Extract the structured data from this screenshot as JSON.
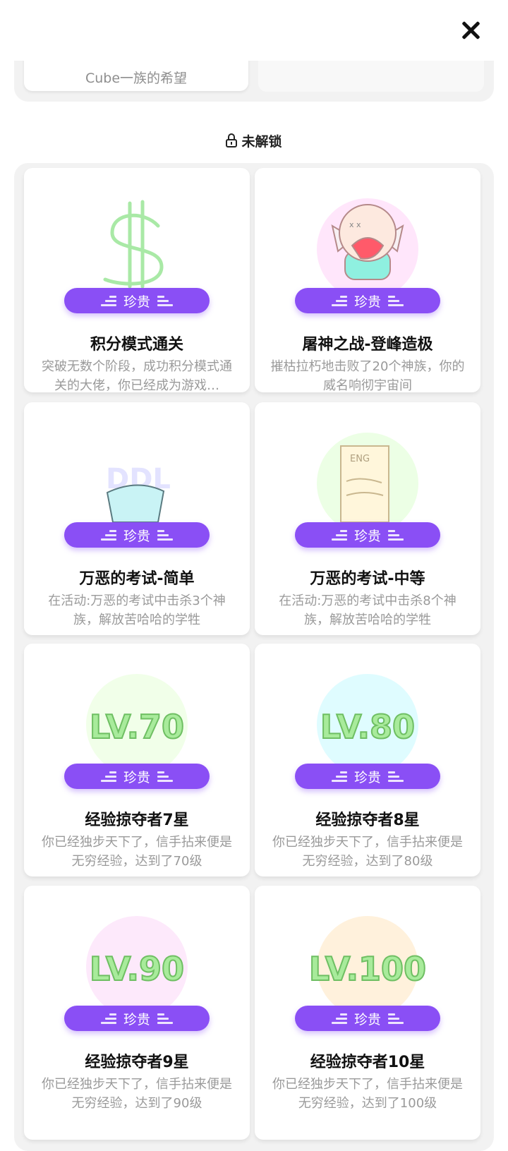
{
  "header": {
    "close_icon": "close-icon"
  },
  "previous": {
    "card_text": "Cube一族的希望"
  },
  "locked_section": {
    "title": "未解锁",
    "icon": "lock-icon"
  },
  "badge_label": "珍贵",
  "colors": {
    "badge": "#8a4ff5",
    "background": "#f2f2f2",
    "title": "#111111",
    "description": "#9a9a9a"
  },
  "cards": [
    {
      "title": "积分模式通关",
      "desc": "突破无数个阶段，成功积分模式通关的大佬，你已经成为游戏…",
      "art": "dollar-sign"
    },
    {
      "title": "屠神之战-登峰造极",
      "desc": "摧枯拉朽地击败了20个神族，你的威名响彻宇宙间",
      "art": "crying-cube"
    },
    {
      "title": "万恶的考试-简单",
      "desc": "在活动:万恶的考试中击杀3个神族，解放苦哈哈的学牲",
      "art": "ddl-ice",
      "art_text": "DDL"
    },
    {
      "title": "万恶的考试-中等",
      "desc": "在活动:万恶的考试中击杀8个神族，解放苦哈哈的学牲",
      "art": "eng-paper",
      "art_text": "ENG"
    },
    {
      "title": "经验掠夺者7星",
      "desc": "你已经独步天下了，信手拈来便是无穷经验，达到了70级",
      "art": "lv",
      "art_text": "LV.70"
    },
    {
      "title": "经验掠夺者8星",
      "desc": "你已经独步天下了，信手拈来便是无穷经验，达到了80级",
      "art": "lv",
      "art_text": "LV.80"
    },
    {
      "title": "经验掠夺者9星",
      "desc": "你已经独步天下了，信手拈来便是无穷经验，达到了90级",
      "art": "lv",
      "art_text": "LV.90"
    },
    {
      "title": "经验掠夺者10星",
      "desc": "你已经独步天下了，信手拈来便是无穷经验，达到了100级",
      "art": "lv",
      "art_text": "LV.100"
    }
  ]
}
